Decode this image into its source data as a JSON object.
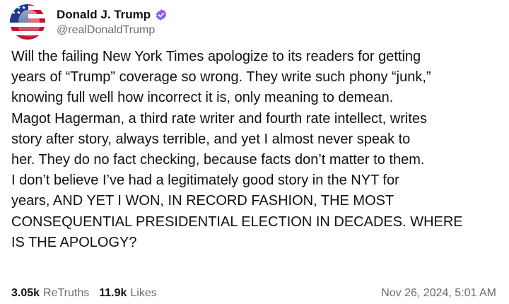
{
  "author": {
    "display_name": "Donald J. Trump",
    "handle": "@realDonaldTrump",
    "verified_icon": "verified-badge-icon",
    "badge_color": "#8b5cf6"
  },
  "post": {
    "text": "Will the failing New York Times apologize to its readers for getting\nyears of “Trump” coverage so wrong. They write such phony “junk,”\nknowing full well how incorrect it is, only meaning to demean.\nMagot Hagerman, a third rate writer and fourth rate intellect, writes\nstory after story, always terrible, and yet I almost never speak to\nher. They do no fact checking, because facts don’t matter to them.\nI don’t believe I’ve had a legitimately good story in the NYT for\nyears, AND YET I WON, IN RECORD FASHION, THE MOST\nCONSEQUENTIAL PRESIDENTIAL ELECTION IN DECADES. WHERE\nIS THE APOLOGY?"
  },
  "stats": {
    "retruths_count": "3.05k",
    "retruths_label": "ReTruths",
    "likes_count": "11.9k",
    "likes_label": "Likes"
  },
  "timestamp": "Nov 26, 2024, 5:01 AM"
}
